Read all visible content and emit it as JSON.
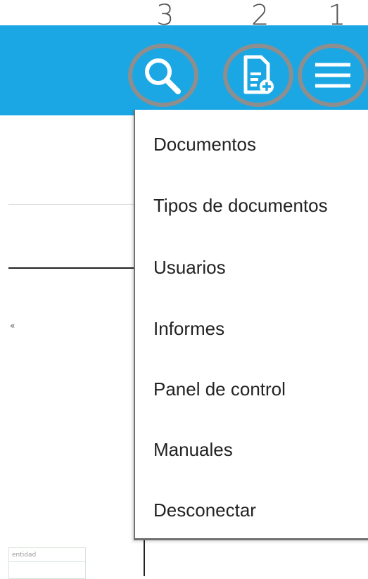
{
  "annotations": {
    "labels": [
      "3",
      "2",
      "1"
    ]
  },
  "toolbar": {
    "search_icon": "search-icon",
    "new_document_icon": "new-document-icon",
    "menu_icon": "hamburger-menu-icon",
    "bar_color": "#1aa7e4",
    "highlight_ring_color": "#8e8e8e"
  },
  "menu": {
    "items": [
      {
        "label": "Documentos"
      },
      {
        "label": "Tipos de documentos"
      },
      {
        "label": "Usuarios"
      },
      {
        "label": "Informes"
      },
      {
        "label": "Panel de control"
      },
      {
        "label": "Manuales"
      },
      {
        "label": "Desconectar"
      }
    ]
  },
  "background": {
    "table_header_fragment": "entidad"
  }
}
